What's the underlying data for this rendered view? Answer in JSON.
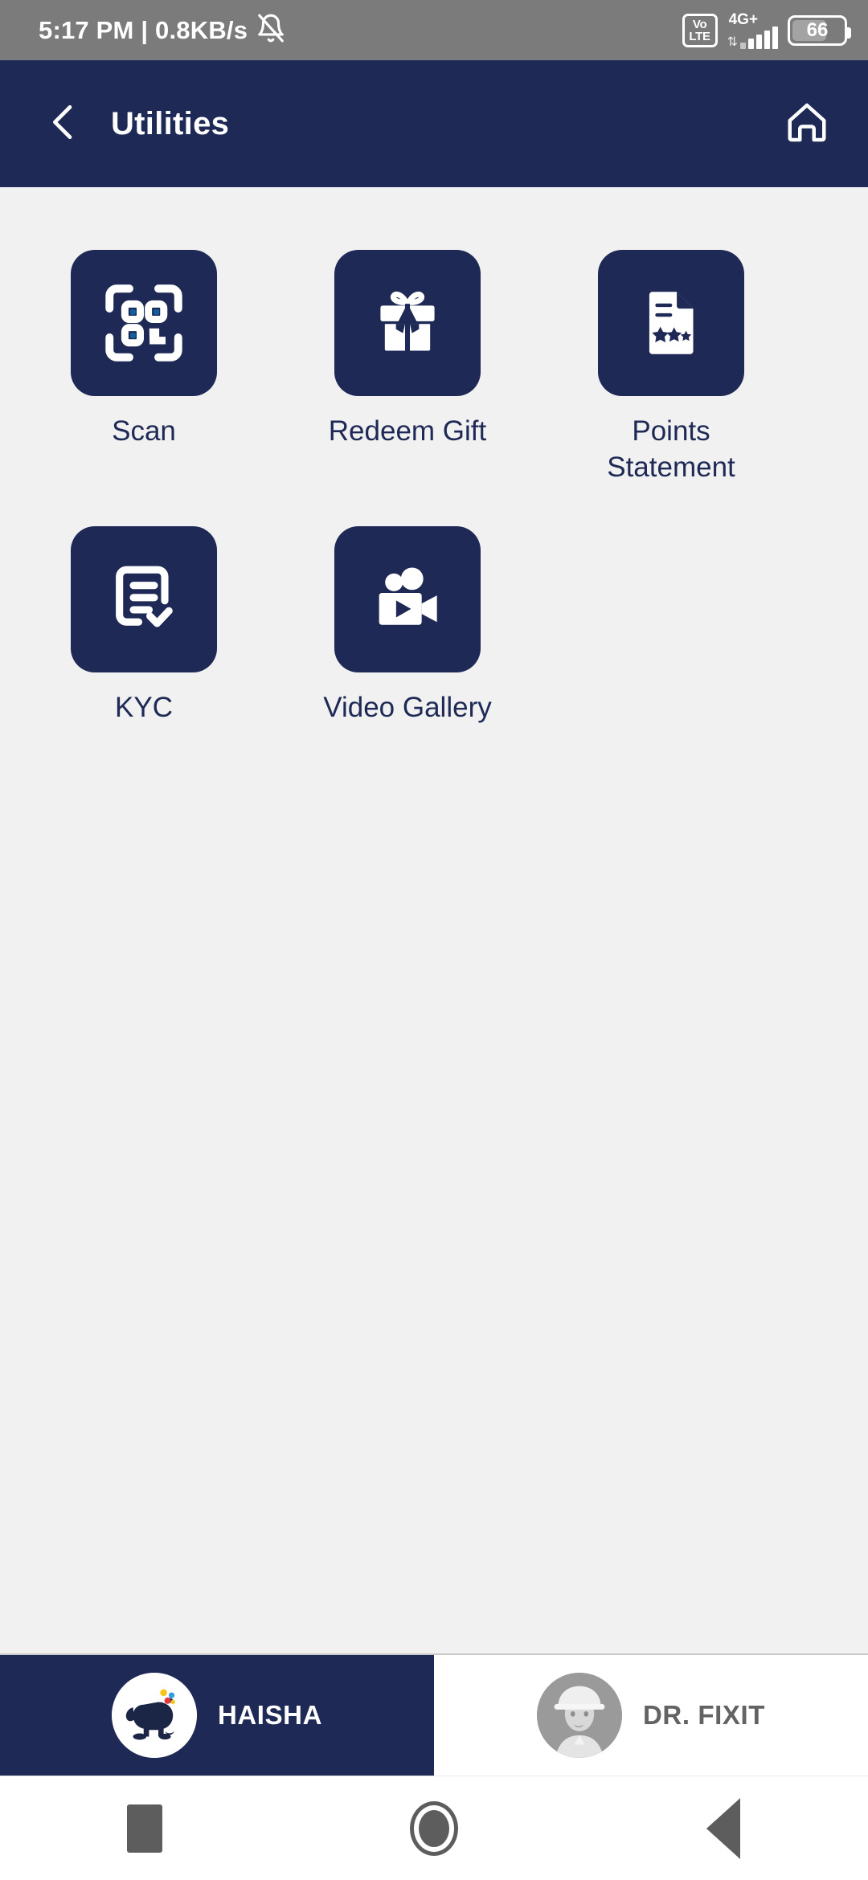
{
  "status_bar": {
    "clock": "5:17 PM | 0.8KB/s",
    "mute_icon": "bell-muted-icon",
    "volte_top": "Vo",
    "volte_bottom": "LTE",
    "network_type": "4G+",
    "data_arrows": "⇅",
    "signal_bars": 5,
    "battery_level": "66",
    "battery_percent": 66,
    "background_color": "#7b7b7b"
  },
  "app_bar": {
    "back_icon": "chevron-left-icon",
    "title": "Utilities",
    "home_icon": "home-icon",
    "background_color": "#1e2a55"
  },
  "content": {
    "background_color": "#f1f1f1",
    "tile_color": "#1e2a55",
    "label_color": "#1e2a55",
    "accent_color": "#10609e",
    "items": [
      {
        "label": "Scan",
        "icon": "qr-scan-icon"
      },
      {
        "label": "Redeem Gift",
        "icon": "gift-icon"
      },
      {
        "label": "Points\nStatement",
        "icon": "document-stars-icon"
      },
      {
        "label": "KYC",
        "icon": "document-checklist-icon"
      },
      {
        "label": "Video Gallery",
        "icon": "video-camera-icon"
      }
    ]
  },
  "brand_tabs": {
    "active_background": "#1e2a55",
    "inactive_background": "#ffffff",
    "items": [
      {
        "label": "HAISHA",
        "avatar": "elephant-logo-avatar",
        "active": true
      },
      {
        "label": "DR. FIXIT",
        "avatar": "engineer-portrait-avatar",
        "active": false
      }
    ]
  },
  "system_nav": {
    "recents_icon": "square-recents-icon",
    "home_icon": "circle-home-icon",
    "back_icon": "triangle-back-icon",
    "background_color": "#ffffff"
  }
}
